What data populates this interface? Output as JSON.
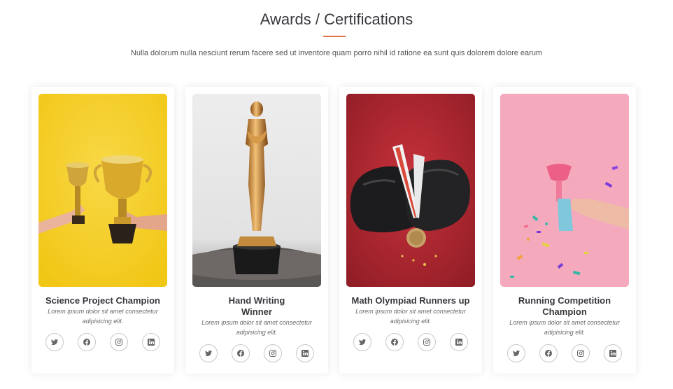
{
  "section": {
    "title": "Awards / Certifications",
    "subtitle": "Nulla dolorum nulla nesciunt rerum facere sed ut inventore quam porro nihil id ratione ea sunt quis dolorem dolore earum",
    "accent_color": "#e0764f"
  },
  "cards": [
    {
      "name": "Science Project Champion",
      "text": "Lorem ipsum dolor sit amet consectetur adipisicing elit.",
      "image": "trophies-on-yellow-photo",
      "socials": [
        "twitter-icon",
        "facebook-icon",
        "instagram-icon",
        "linkedin-icon"
      ]
    },
    {
      "name": "Hand Writing Winner",
      "text": "Lorem ipsum dolor sit amet consectetur adipisicing elit.",
      "image": "golden-statuette-photo",
      "socials": [
        "twitter-icon",
        "facebook-icon",
        "instagram-icon",
        "linkedin-icon"
      ]
    },
    {
      "name": "Math Olympiad Runners up",
      "text": "Lorem ipsum dolor sit amet consectetur adipisicing elit.",
      "image": "medal-and-gloves-photo",
      "socials": [
        "twitter-icon",
        "facebook-icon",
        "instagram-icon",
        "linkedin-icon"
      ]
    },
    {
      "name": "Running Competition Champion",
      "text": "Lorem ipsum dolor sit amet consectetur adipisicing elit.",
      "image": "pink-confetti-trophy-photo",
      "socials": [
        "twitter-icon",
        "facebook-icon",
        "instagram-icon",
        "linkedin-icon"
      ]
    }
  ]
}
